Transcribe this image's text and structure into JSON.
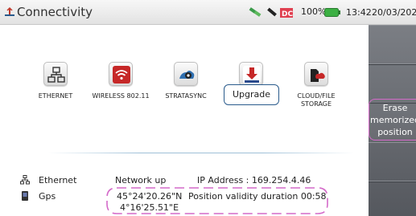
{
  "header": {
    "title": "Connectivity",
    "battery_percent": "100%",
    "time": "13:42",
    "date": "20/03/2020"
  },
  "tiles": [
    {
      "label": "ETHERNET",
      "icon": "network-icon"
    },
    {
      "label": "WIRELESS 802.11",
      "icon": "wifi-icon"
    },
    {
      "label": "STRATASYNC",
      "icon": "stratasync-icon"
    },
    {
      "label": "Upgrade",
      "icon": "download-icon"
    },
    {
      "label_line1": "CLOUD/FILE",
      "label_line2": "STORAGE",
      "icon": "cloud-file-icon"
    }
  ],
  "side_panel": {
    "erase_line1": "Erase",
    "erase_line2": "memorized",
    "erase_line3": "position"
  },
  "status": {
    "ethernet": {
      "name": "Ethernet",
      "state": "Network up",
      "ip": "IP Address : 169.254.4.46"
    },
    "gps": {
      "name": "Gps",
      "lat": "45°24'20.26\"N",
      "lon": "4°16'25.51\"E",
      "validity": "Position validity duration 00:58"
    }
  },
  "colors": {
    "accent_magenta": "#d46ac9",
    "upgrade_border": "#2a5b8c",
    "panel_gray": "#6a6d73",
    "wifi_red": "#c62828",
    "battery_green": "#3cb043"
  }
}
